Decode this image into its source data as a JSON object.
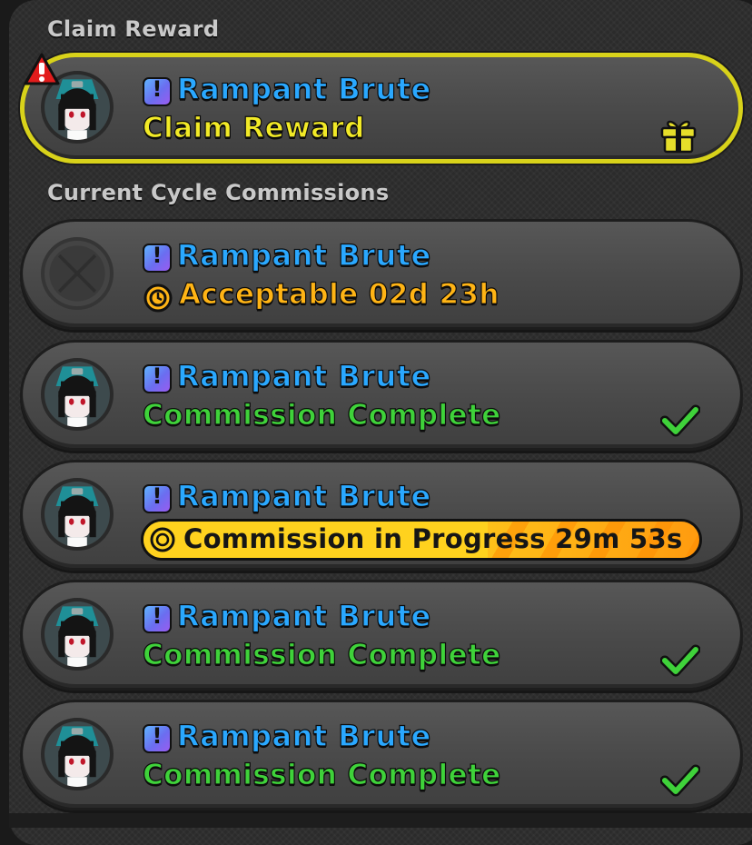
{
  "sections": {
    "claim_title": "Claim Reward",
    "current_title": "Current Cycle Commissions"
  },
  "claim_card": {
    "title": "Rampant Brute",
    "status": "Claim Reward",
    "alert_icon": "exclamation-alert-icon",
    "right_icon": "gift-icon"
  },
  "commissions": [
    {
      "title": "Rampant Brute",
      "status": "Acceptable 02d 23h",
      "type": "acceptable",
      "avatar": "empty-slot",
      "icon": "clock-icon"
    },
    {
      "title": "Rampant Brute",
      "status": "Commission Complete",
      "type": "complete",
      "icon": "checkmark-icon"
    },
    {
      "title": "Rampant Brute",
      "status": "Commission in Progress 29m 53s",
      "type": "progress",
      "icon": "clock-icon"
    },
    {
      "title": "Rampant Brute",
      "status": "Commission Complete",
      "type": "complete",
      "icon": "checkmark-icon"
    },
    {
      "title": "Rampant Brute",
      "status": "Commission Complete",
      "type": "complete",
      "icon": "checkmark-icon"
    }
  ],
  "colors": {
    "title_blue": "#2aa8ff",
    "claim_yellow": "#f2ea27",
    "complete_green": "#3fd23a",
    "acceptable_orange": "#ffb415",
    "highlight_border": "#d8d21a"
  }
}
